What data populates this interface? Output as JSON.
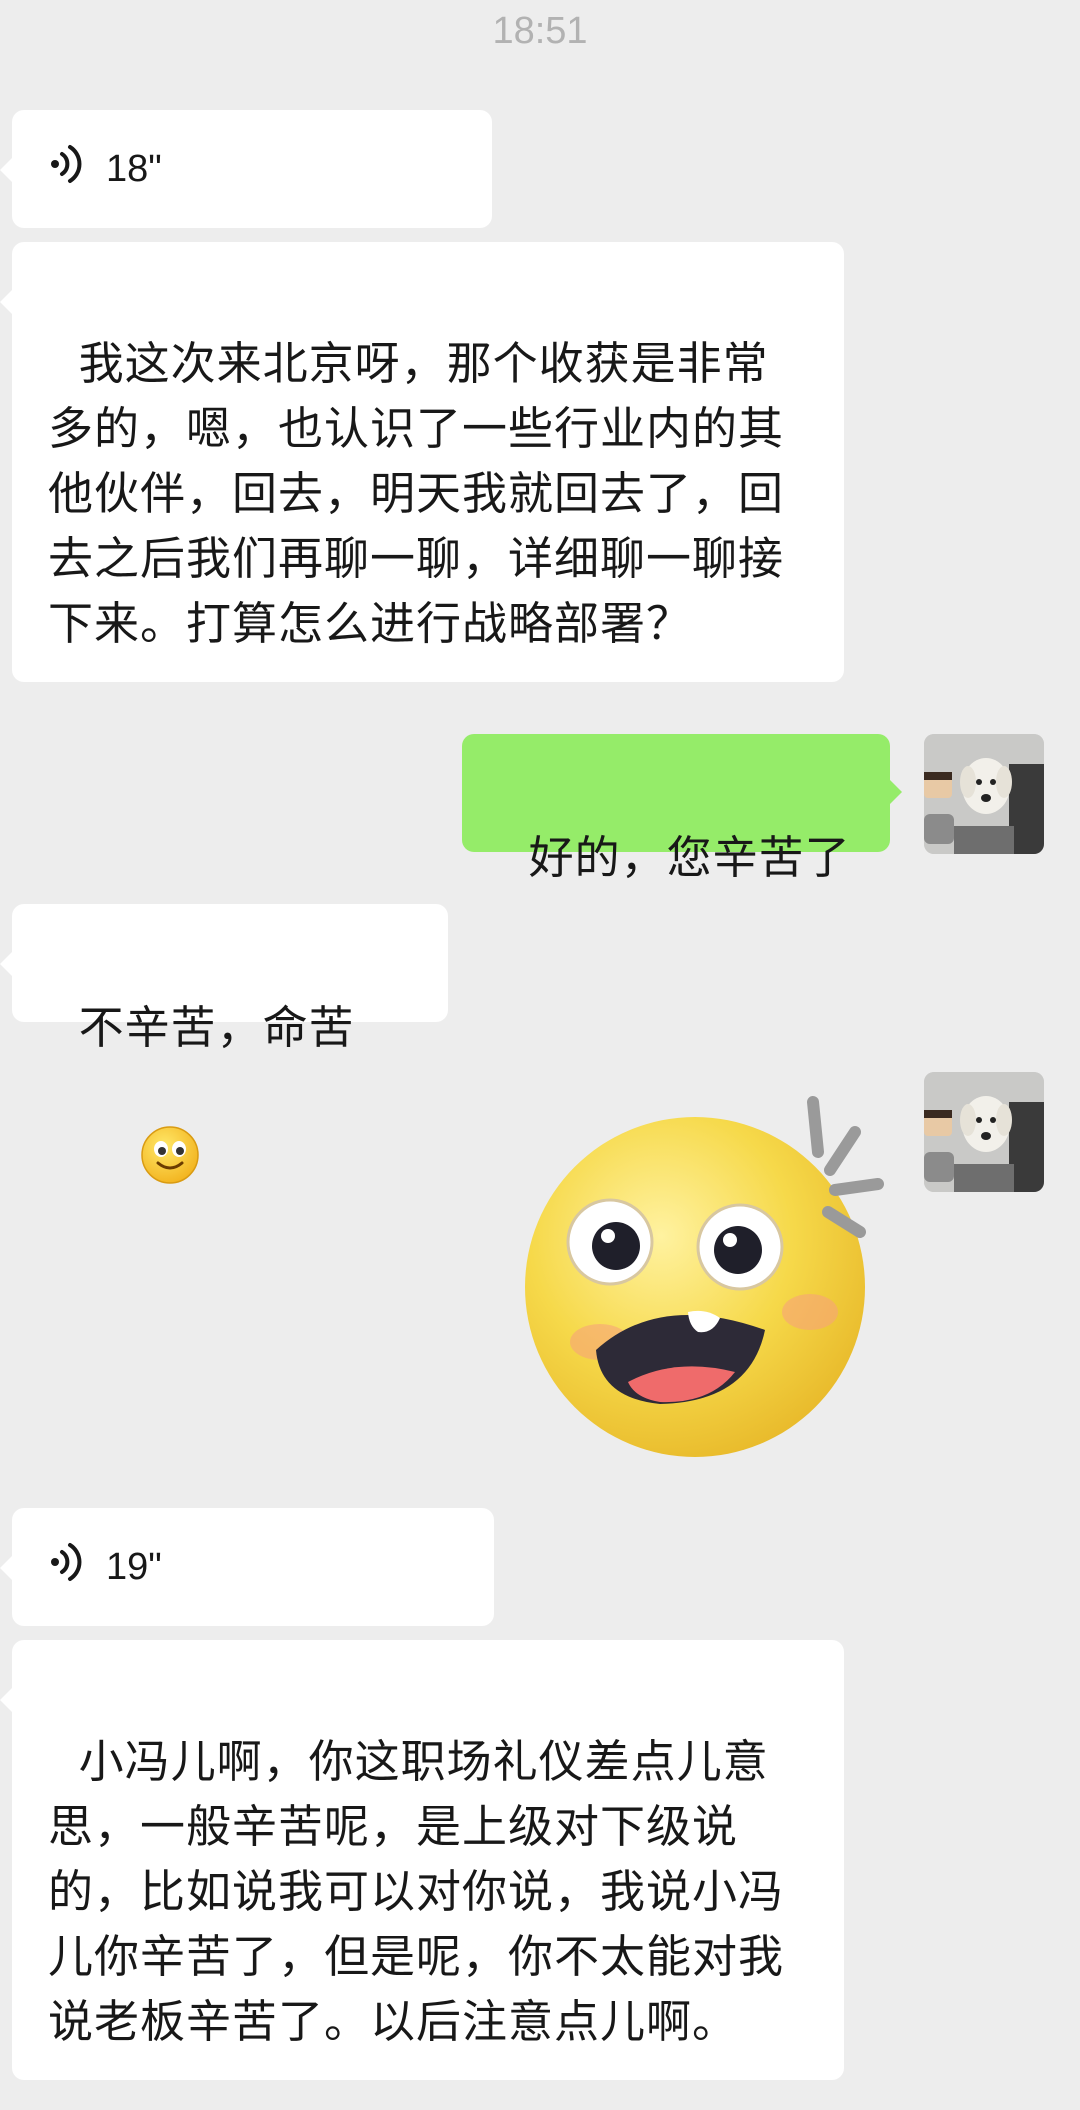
{
  "header": {
    "time": "18:51"
  },
  "messages": {
    "voice1": {
      "duration": "18\""
    },
    "text1": {
      "content": "我这次来北京呀，那个收获是非常多的，嗯，也认识了一些行业内的其他伙伴，回去，明天我就回去了，回去之后我们再聊一聊，详细聊一聊接下来。打算怎么进行战略部署？"
    },
    "reply1": {
      "content": "好的，您辛苦了"
    },
    "text2": {
      "content": "不辛苦，命苦",
      "emoji": "slight-smile-emoji"
    },
    "sticker": {
      "icon": "surprised-face-sticker"
    },
    "voice2": {
      "duration": "19\""
    },
    "text3": {
      "content": "小冯儿啊，你这职场礼仪差点儿意思，一般辛苦呢，是上级对下级说的，比如说我可以对你说，我说小冯儿你辛苦了，但是呢，你不太能对我说老板辛苦了。以后注意点儿啊。"
    }
  },
  "colors": {
    "background": "#ededed",
    "incoming_bubble": "#ffffff",
    "outgoing_bubble": "#95ec69"
  }
}
